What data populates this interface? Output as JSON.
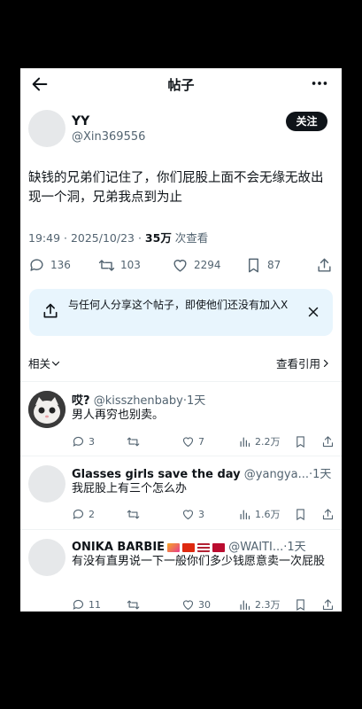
{
  "header": {
    "title": "帖子"
  },
  "post": {
    "name": "YY",
    "handle": "@Xin369556",
    "follow_label": "关注",
    "text": "缺钱的兄弟们记住了，你们屁股上面不会无缘无故出现一个洞，兄弟我点到为止",
    "time": "19:49 · 2025/10/23 · ",
    "views": "35万",
    "views_suffix": " 次查看",
    "stats": {
      "replies": "136",
      "retweets": "103",
      "likes": "2294",
      "bookmarks": "87"
    }
  },
  "share_card": {
    "text": "与任何人分享这个帖子，即使他们还没有加入X"
  },
  "tabs": {
    "related": "相关",
    "quotes": "查看引用"
  },
  "replies": [
    {
      "name": "哎?",
      "handle": "@kisszhenbaby",
      "time": "·1天",
      "text": "男人再穷也别卖。",
      "replies": "3",
      "retweets": "",
      "likes": "7",
      "views": "2.2万"
    },
    {
      "name": "Glasses girls save the day",
      "handle": "@yangya...",
      "time": "·1天",
      "text": "我屁股上有三个怎么办",
      "replies": "2",
      "retweets": "",
      "likes": "3",
      "views": "1.6万"
    },
    {
      "name": "ONIKA BARBIE",
      "handle": "@WAITI...",
      "time": "·1天",
      "text": "有没有直男说一下一般你们多少钱愿意卖一次屁股",
      "replies": "11",
      "retweets": "",
      "likes": "30",
      "views": "2.3万"
    }
  ],
  "colors": {
    "text": "#0f1419",
    "muted": "#536471",
    "share_bg": "#e8f5fd",
    "divider": "#eff3f4"
  }
}
